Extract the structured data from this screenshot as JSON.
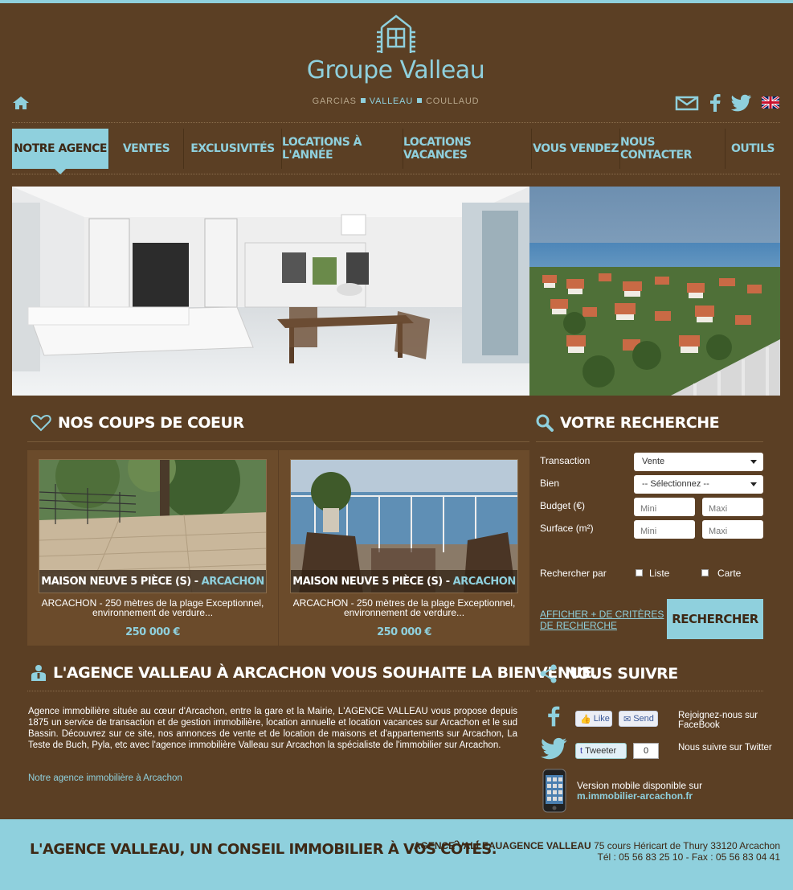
{
  "header": {
    "logo_name": "Groupe Valleau",
    "logo_sub_1": "GARCIAS",
    "logo_sub_2": "VALLEAU",
    "logo_sub_3": "COULLAUD",
    "icons": [
      "home-icon",
      "mail-icon",
      "facebook-icon",
      "twitter-icon",
      "english-flag-icon"
    ]
  },
  "nav": {
    "items": [
      {
        "label": "Notre agence",
        "active": true
      },
      {
        "label": "Ventes"
      },
      {
        "label": "Exclusivités"
      },
      {
        "label": "Locations à l'année"
      },
      {
        "label": "Locations vacances"
      },
      {
        "label": "Vous vendez"
      },
      {
        "label": "Nous contacter"
      },
      {
        "label": "Outils"
      }
    ]
  },
  "coups_de_coeur": {
    "title": "Nos coups de coeur",
    "cards": [
      {
        "title": "Maison neuve 5 pièce (s) -",
        "city": "Arcachon",
        "desc": "ARCACHON - 250 mètres de la plage Exceptionnel, environnement de verdure...",
        "price": "250 000 €"
      },
      {
        "title": "Maison neuve 5 pièce (s) -",
        "city": "Arcachon",
        "desc": "ARCACHON - 250 mètres de la plage Exceptionnel, environnement de verdure...",
        "price": "250 000 €"
      }
    ]
  },
  "search": {
    "title": "Votre recherche",
    "transaction_label": "Transaction",
    "transaction_value": "Vente",
    "bien_label": "Bien",
    "bien_value": "-- Sélectionnez --",
    "budget_label": "Budget (€)",
    "surface_label": "Surface (m²)",
    "mini_placeholder": "Mini",
    "maxi_placeholder": "Maxi",
    "search_by_label": "Rechercher par",
    "opt_liste": "Liste",
    "opt_carte": "Carte",
    "more_criteria": "Afficher + de critères de recherche",
    "submit": "Rechercher"
  },
  "welcome": {
    "title": "L'agence Valleau à Arcachon vous souhaite la bienvenue.",
    "text": "Agence immobilière située au cœur d'Arcachon, entre la gare et la Mairie, L'AGENCE VALLEAU vous propose depuis 1875 un service de transaction et de gestion immobilière, location annuelle et location vacances sur Arcachon et le sud Bassin. Découvrez sur ce site, nos annonces de vente et de location de maisons et d'appartements sur Arcachon, La Teste de Buch, Pyla, etc avec l'agence immobilière Valleau sur Arcachon la spécialiste de l'immobilier sur Arcachon.",
    "link": "Notre agence immobilière à Arcachon"
  },
  "follow": {
    "title": "Nous suivre",
    "like": "Like",
    "send": "Send",
    "fb_text": "Rejoignez-nous sur FaceBook",
    "tweet": "Tweeter",
    "tweet_count": "0",
    "tw_text": "Nous suivre sur Twitter",
    "mobile_text": "Version mobile disponible sur",
    "mobile_url": "m.immobilier-arcachon.fr"
  },
  "footer": {
    "slogan": "L'agence Valleau, un conseil immobilier à vos côtés.",
    "agency_name": "AGENCE VALLEAUAGENCE VALLEAU",
    "address": "75 cours Héricart de Thury 33120 Arcachon",
    "phones": "Tél : 05 56 83 25 10 - Fax : 05 56 83 04 41"
  },
  "colors": {
    "background": "#5b3f24",
    "accent": "#8fd0dd",
    "panel": "#6b4b2b"
  }
}
